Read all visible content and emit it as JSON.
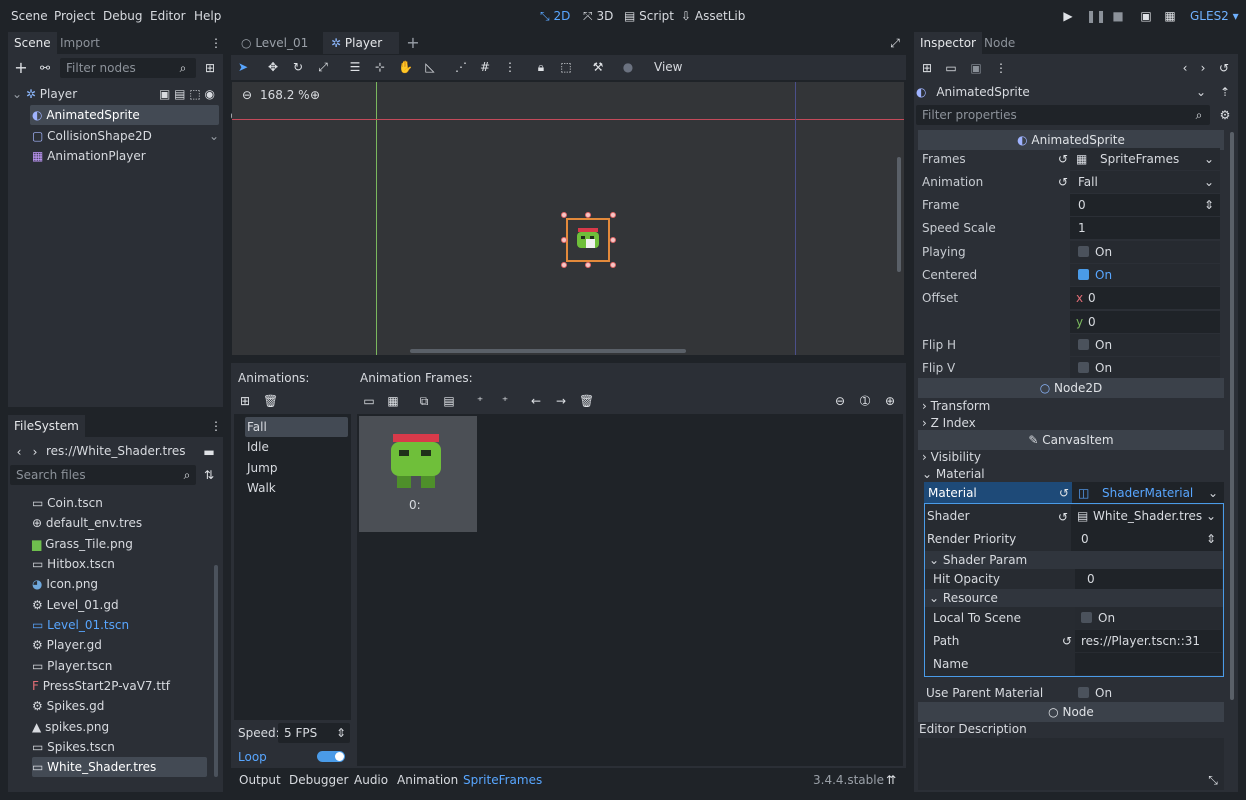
{
  "menu": {
    "items": [
      "Scene",
      "Project",
      "Debug",
      "Editor",
      "Help"
    ]
  },
  "workspaces": {
    "items": [
      "2D",
      "3D",
      "Script",
      "AssetLib"
    ],
    "active": "2D"
  },
  "renderer": "GLES2",
  "scene_dock": {
    "tabs": [
      "Scene",
      "Import"
    ],
    "filter_placeholder": "Filter nodes",
    "nodes": [
      {
        "label": "Player",
        "depth": 0,
        "icon": "player-node-icon"
      },
      {
        "label": "AnimatedSprite",
        "depth": 1,
        "icon": "animated-sprite-icon"
      },
      {
        "label": "CollisionShape2D",
        "depth": 1,
        "icon": "collision-shape-icon"
      },
      {
        "label": "AnimationPlayer",
        "depth": 1,
        "icon": "animation-player-icon"
      }
    ]
  },
  "filesystem": {
    "tab": "FileSystem",
    "path": "res://White_Shader.tres",
    "search_placeholder": "Search files",
    "files": [
      {
        "name": "Coin.tscn",
        "icon": "scene-icon"
      },
      {
        "name": "default_env.tres",
        "icon": "environment-icon"
      },
      {
        "name": "Grass_Tile.png",
        "icon": "image-icon"
      },
      {
        "name": "Hitbox.tscn",
        "icon": "scene-icon"
      },
      {
        "name": "Icon.png",
        "icon": "godot-icon"
      },
      {
        "name": "Level_01.gd",
        "icon": "gear-icon"
      },
      {
        "name": "Level_01.tscn",
        "icon": "scene-icon"
      },
      {
        "name": "Player.gd",
        "icon": "gear-icon"
      },
      {
        "name": "Player.tscn",
        "icon": "scene-icon"
      },
      {
        "name": "PressStart2P-vaV7.ttf",
        "icon": "font-icon"
      },
      {
        "name": "Spikes.gd",
        "icon": "gear-icon"
      },
      {
        "name": "spikes.png",
        "icon": "image-icon"
      },
      {
        "name": "Spikes.tscn",
        "icon": "scene-icon"
      },
      {
        "name": "White_Shader.tres",
        "icon": "shader-icon"
      }
    ]
  },
  "editor_tabs": [
    "Level_01",
    "Player"
  ],
  "toolbar": {
    "view_label": "View"
  },
  "viewport": {
    "zoom": "168.2 %"
  },
  "spriteframes": {
    "animations_label": "Animations:",
    "frames_label": "Animation Frames:",
    "animations": [
      "Fall",
      "Idle",
      "Jump",
      "Walk"
    ],
    "frame_caption": "0:",
    "speed_label": "Speed:",
    "speed_value": "5 FPS",
    "loop_label": "Loop"
  },
  "bottom_panel": {
    "tabs": [
      "Output",
      "Debugger",
      "Audio",
      "Animation",
      "SpriteFrames"
    ],
    "version": "3.4.4.stable"
  },
  "inspector": {
    "tabs": [
      "Inspector",
      "Node"
    ],
    "object": "AnimatedSprite",
    "filter_placeholder": "Filter properties",
    "section_title": "AnimatedSprite",
    "props": [
      {
        "label": "Frames",
        "value": "SpriteFrames"
      },
      {
        "label": "Animation",
        "value": "Fall"
      },
      {
        "label": "Frame",
        "value": "0"
      },
      {
        "label": "Speed Scale",
        "value": "1"
      },
      {
        "label": "Playing",
        "value": "On"
      },
      {
        "label": "Centered",
        "value": "On"
      },
      {
        "label": "Offset",
        "value": "0"
      },
      {
        "label": "",
        "value": "0"
      },
      {
        "label": "Flip H",
        "value": "On"
      },
      {
        "label": "Flip V",
        "value": "On"
      }
    ],
    "offset_axes": [
      "x",
      "y"
    ],
    "node2d_title": "Node2D",
    "node2d_groups": [
      "Transform",
      "Z Index"
    ],
    "canvasitem_title": "CanvasItem",
    "canvas_groups": [
      "Visibility",
      "Material"
    ],
    "material": {
      "label": "Material",
      "value": "ShaderMaterial"
    },
    "shader": {
      "label": "Shader",
      "value": "White_Shader.tres"
    },
    "render_priority": {
      "label": "Render Priority",
      "value": "0"
    },
    "shader_param_title": "Shader Param",
    "hit_opacity": {
      "label": "Hit Opacity",
      "value": "0"
    },
    "resource_title": "Resource",
    "local_to_scene": {
      "label": "Local To Scene",
      "value": "On"
    },
    "path": {
      "label": "Path",
      "value": "res://Player.tscn::31"
    },
    "name": {
      "label": "Name",
      "value": ""
    },
    "use_parent": {
      "label": "Use Parent Material",
      "value": "On"
    },
    "node_title": "Node",
    "editor_description": "Editor Description"
  },
  "colors": {
    "accent": "#58a6ff",
    "bg": "#1f2328",
    "panel": "#2b2f36"
  }
}
